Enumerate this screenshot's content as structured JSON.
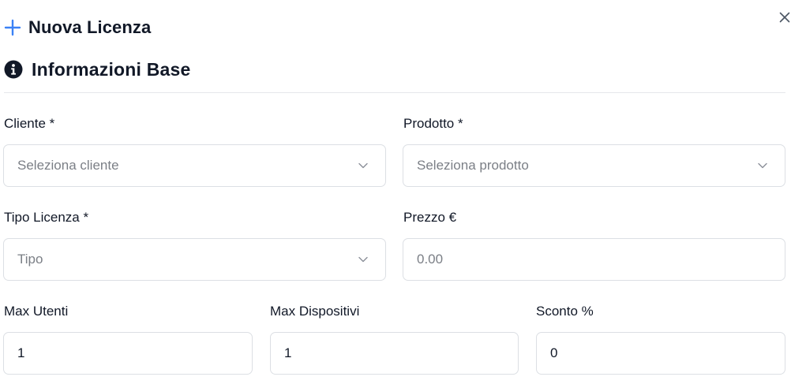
{
  "modal": {
    "title": "Nuova Licenza",
    "close_label": "×"
  },
  "section": {
    "title": "Informazioni Base"
  },
  "fields": {
    "cliente": {
      "label": "Cliente *",
      "placeholder": "Seleziona cliente"
    },
    "prodotto": {
      "label": "Prodotto *",
      "placeholder": "Seleziona prodotto"
    },
    "tipo_licenza": {
      "label": "Tipo Licenza *",
      "placeholder": "Tipo"
    },
    "prezzo": {
      "label": "Prezzo €",
      "placeholder": "0.00",
      "value": ""
    },
    "max_utenti": {
      "label": "Max Utenti",
      "value": "1"
    },
    "max_dispositivi": {
      "label": "Max Dispositivi",
      "value": "1"
    },
    "sconto": {
      "label": "Sconto %",
      "value": "0"
    }
  },
  "icons": {
    "plus": "plus-icon",
    "info": "info-icon",
    "close": "close-icon",
    "chevron": "chevron-down-icon"
  },
  "colors": {
    "accent": "#3b82f6",
    "text": "#111827",
    "placeholder": "#7b7f86",
    "border": "#dcdfe4"
  }
}
